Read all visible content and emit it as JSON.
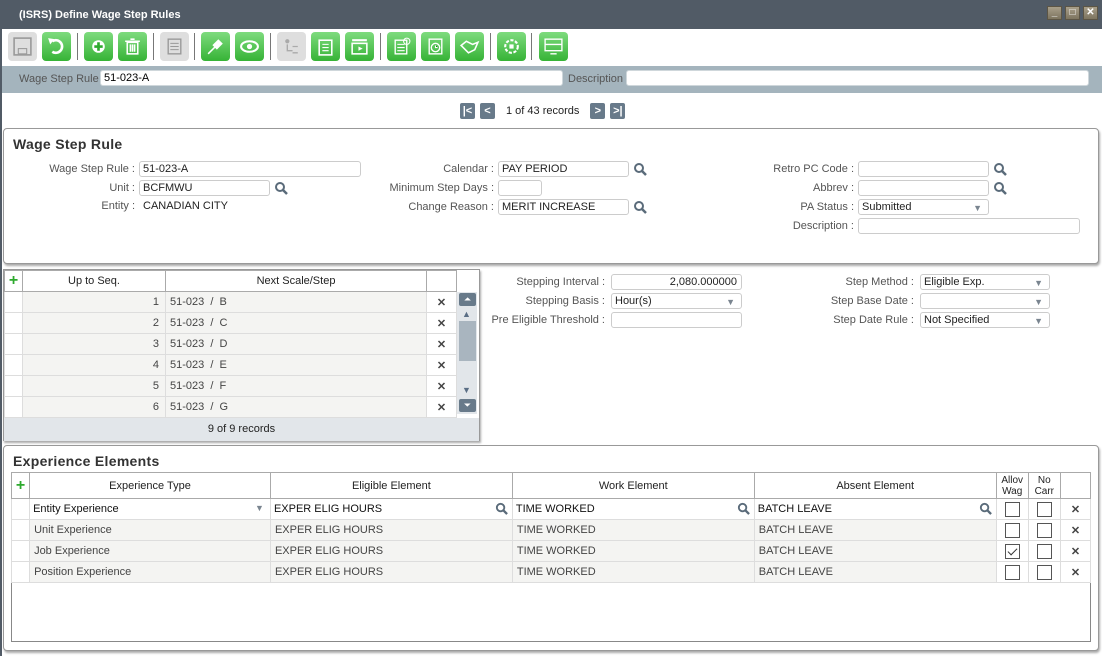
{
  "window": {
    "title": "(ISRS) Define Wage Step Rules",
    "controls": [
      "minimize",
      "maximize",
      "close"
    ]
  },
  "toolbar": {
    "buttons": [
      {
        "name": "save",
        "icon": "floppy-disk-icon",
        "enabled": false
      },
      {
        "name": "undo",
        "icon": "undo-icon",
        "enabled": true
      },
      {
        "name": "add",
        "icon": "add-icon",
        "enabled": true
      },
      {
        "name": "delete",
        "icon": "trash-icon",
        "enabled": true
      },
      {
        "name": "notes",
        "icon": "notepad-icon",
        "enabled": false
      },
      {
        "name": "attach",
        "icon": "pin-icon",
        "enabled": true
      },
      {
        "name": "view",
        "icon": "eye-icon",
        "enabled": true
      },
      {
        "name": "hierarchy",
        "icon": "org-chart-icon",
        "enabled": false
      },
      {
        "name": "clipboard",
        "icon": "clipboard-icon",
        "enabled": true
      },
      {
        "name": "media",
        "icon": "clapperboard-icon",
        "enabled": true
      },
      {
        "name": "report",
        "icon": "report-icon",
        "enabled": true
      },
      {
        "name": "schedule",
        "icon": "clock-notepad-icon",
        "enabled": true
      },
      {
        "name": "handshake",
        "icon": "handshake-icon",
        "enabled": true
      },
      {
        "name": "settings",
        "icon": "gear-icon",
        "enabled": true
      },
      {
        "name": "display",
        "icon": "monitor-icon",
        "enabled": true
      }
    ]
  },
  "keybar": {
    "rule_label": "Wage Step Rule",
    "rule_value": "51-023-A",
    "description_label": "Description",
    "description_value": ""
  },
  "navigation": {
    "record_text": "1 of 43 records"
  },
  "wage_step_rule": {
    "heading": "Wage Step Rule",
    "wage_step_rule_label": "Wage Step Rule :",
    "wage_step_rule_value": "51-023-A",
    "unit_label": "Unit :",
    "unit_value": "BCFMWU",
    "entity_label": "Entity :",
    "entity_value": "CANADIAN CITY",
    "calendar_label": "Calendar :",
    "calendar_value": "PAY PERIOD",
    "min_step_days_label": "Minimum Step Days :",
    "min_step_days_value": "",
    "change_reason_label": "Change Reason :",
    "change_reason_value": "MERIT INCREASE",
    "retro_pc_code_label": "Retro PC Code :",
    "retro_pc_code_value": "",
    "abbrev_label": "Abbrev :",
    "abbrev_value": "",
    "pa_status_label": "PA Status :",
    "pa_status_value": "Submitted",
    "description_label": "Description :",
    "description_value": ""
  },
  "steps_grid": {
    "headers": [
      "Up to Seq.",
      "Next Scale/Step"
    ],
    "rows": [
      {
        "seq": "1",
        "next": "51-023  /  B"
      },
      {
        "seq": "2",
        "next": "51-023  /  C"
      },
      {
        "seq": "3",
        "next": "51-023  /  D"
      },
      {
        "seq": "4",
        "next": "51-023  /  E"
      },
      {
        "seq": "5",
        "next": "51-023  /  F"
      },
      {
        "seq": "6",
        "next": "51-023  /  G"
      }
    ],
    "footer": "9 of 9 records"
  },
  "stepping": {
    "interval_label": "Stepping Interval :",
    "interval_value": "2,080.000000",
    "basis_label": "Stepping Basis :",
    "basis_value": "Hour(s)",
    "threshold_label": "Pre Eligible Threshold :",
    "threshold_value": "",
    "method_label": "Step Method :",
    "method_value": "Eligible Exp.",
    "base_date_label": "Step Base Date :",
    "base_date_value": "",
    "date_rule_label": "Step Date Rule :",
    "date_rule_value": "Not Specified"
  },
  "experience": {
    "heading": "Experience Elements",
    "headers": [
      "Experience Type",
      "Eligible Element",
      "Work Element",
      "Absent Element",
      "Allov Wag",
      "No Carr"
    ],
    "rows": [
      {
        "type": "Entity Experience",
        "eligible": "EXPER ELIG HOURS",
        "work": "TIME WORKED",
        "absent": "BATCH LEAVE",
        "allow": false,
        "nocarry": false
      },
      {
        "type": "Unit Experience",
        "eligible": "EXPER ELIG HOURS",
        "work": "TIME WORKED",
        "absent": "BATCH LEAVE",
        "allow": false,
        "nocarry": false
      },
      {
        "type": "Job Experience",
        "eligible": "EXPER ELIG HOURS",
        "work": "TIME WORKED",
        "absent": "BATCH LEAVE",
        "allow": true,
        "nocarry": false
      },
      {
        "type": "Position Experience",
        "eligible": "EXPER ELIG HOURS",
        "work": "TIME WORKED",
        "absent": "BATCH LEAVE",
        "allow": false,
        "nocarry": false
      }
    ]
  }
}
